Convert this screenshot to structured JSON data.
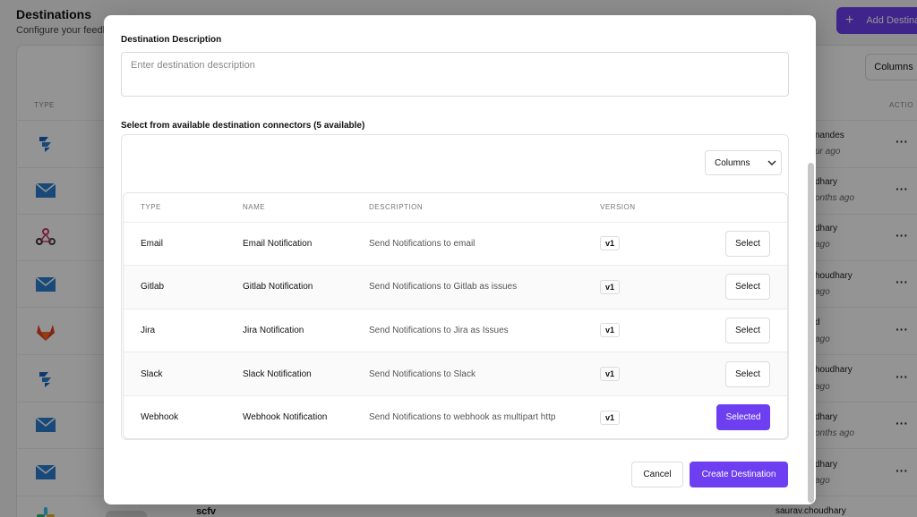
{
  "background": {
    "title": "Destinations",
    "subtitle": "Configure your feedba",
    "add_button_label": "Add Destina",
    "columns_label": "Columns",
    "type_header": "TYPE",
    "action_header": "ACTIO",
    "rows": [
      {
        "icon": "jira-icon",
        "user": "nandes",
        "time": "ur ago"
      },
      {
        "icon": "email-icon",
        "user": "dhary",
        "time": "onths ago"
      },
      {
        "icon": "webhook-icon",
        "user": "dhary",
        "time": "ago"
      },
      {
        "icon": "email-icon",
        "user": "houdhary",
        "time": "ago"
      },
      {
        "icon": "gitlab-icon",
        "user": "d",
        "time": "ago"
      },
      {
        "icon": "jira-icon",
        "user": "houdhary",
        "time": "ago"
      },
      {
        "icon": "email-icon",
        "user": "dhary",
        "time": "onths ago"
      },
      {
        "icon": "email-icon",
        "user": "dhary",
        "time": "ago"
      }
    ],
    "last_row_name": "scfv",
    "last_row_user": "saurav.choudhary",
    "colors": {
      "accent": "#6d3ff0",
      "email": "#2a7fd1",
      "jira": "#1a5fc9",
      "gitlab": "#e24329",
      "webhook": "#c73a63"
    }
  },
  "modal": {
    "description_label": "Destination Description",
    "description_placeholder": "Enter destination description",
    "connectors_label": "Select from available destination connectors (5 available)",
    "columns_button": "Columns",
    "table": {
      "headers": [
        "TYPE",
        "NAME",
        "DESCRIPTION",
        "VERSION"
      ],
      "rows": [
        {
          "type": "Email",
          "name": "Email Notification",
          "description": "Send Notifications to email",
          "version": "v1",
          "action": "Select"
        },
        {
          "type": "Gitlab",
          "name": "Gitlab Notification",
          "description": "Send Notifications to Gitlab as issues",
          "version": "v1",
          "action": "Select"
        },
        {
          "type": "Jira",
          "name": "Jira Notification",
          "description": "Send Notifications to Jira as Issues",
          "version": "v1",
          "action": "Select"
        },
        {
          "type": "Slack",
          "name": "Slack Notification",
          "description": "Send Notifications to Slack",
          "version": "v1",
          "action": "Select"
        },
        {
          "type": "Webhook",
          "name": "Webhook Notification",
          "description": "Send Notifications to webhook as multipart http",
          "version": "v1",
          "action": "Selected"
        }
      ]
    },
    "cancel_label": "Cancel",
    "create_label": "Create Destination"
  }
}
